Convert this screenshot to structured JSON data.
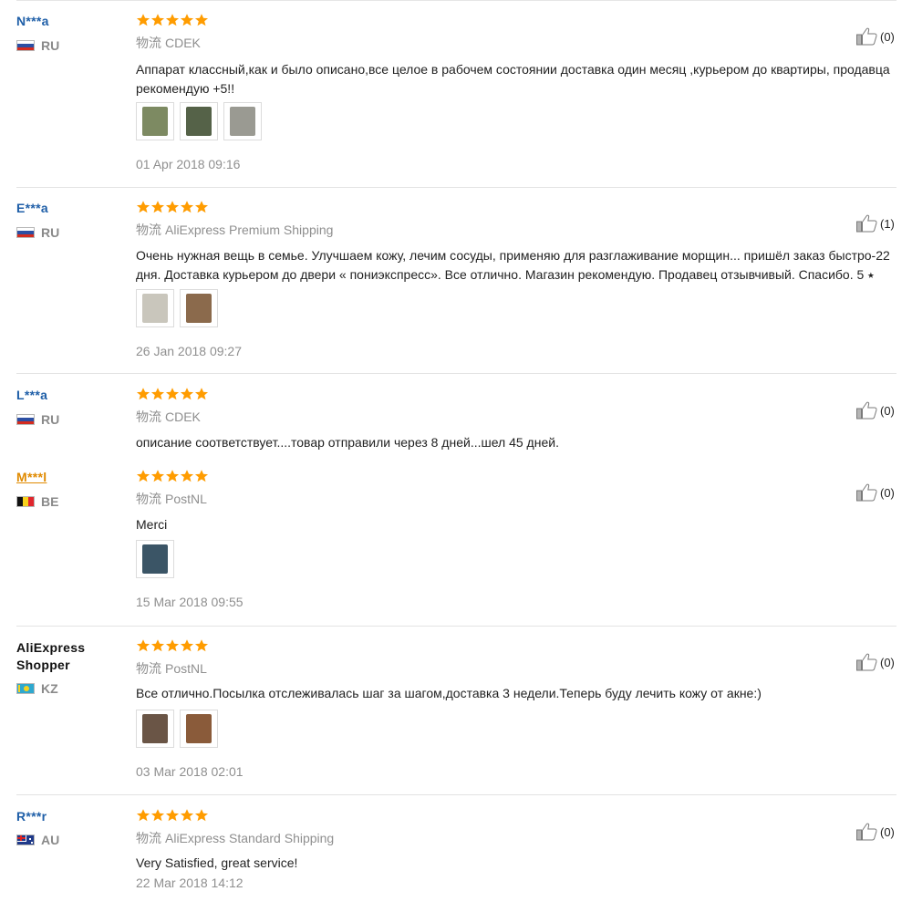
{
  "reviews": [
    {
      "user": "N***a",
      "country": "RU",
      "flag": "ru",
      "stars": 5,
      "logistics_label": "物流",
      "logistics": "CDEK",
      "text": "Аппарат классный,как и было описано,все целое в рабочем состоянии доставка один месяц ,курьером до квартиры, продавца рекомендую +5!!",
      "photos": [
        "photo",
        "photo",
        "photo"
      ],
      "date": "01 Apr 2018 09:16",
      "helpful": "(0)"
    },
    {
      "user": "E***a",
      "country": "RU",
      "flag": "ru",
      "stars": 5,
      "logistics_label": "物流",
      "logistics": "AliExpress Premium Shipping",
      "text": "Очень нужная вещь в семье. Улучшаем кожу, лечим сосуды, применяю для разглаживание морщин... пришёл заказ быстро-22 дня. Доставка курьером до двери « пониэкспресс». Все отлично. Магазин рекомендую. Продавец отзывчивый. Спасибо. 5 ⭑",
      "photos": [
        "photo",
        "photo"
      ],
      "date": "26 Jan 2018 09:27",
      "helpful": "(1)"
    },
    {
      "user": "L***a",
      "country": "RU",
      "flag": "ru",
      "stars": 5,
      "logistics_label": "物流",
      "logistics": "CDEK",
      "text": "описание соответствует....товар отправили через 8 дней...шел 45 дней.",
      "photos": [],
      "date": "",
      "helpful": "(0)"
    },
    {
      "user": "M***l",
      "country": "BE",
      "flag": "be",
      "stars": 5,
      "logistics_label": "物流",
      "logistics": "PostNL",
      "text": "Merci",
      "photos": [
        "photo"
      ],
      "date": "15 Mar 2018 09:55",
      "helpful": "(0)"
    },
    {
      "user": "AliExpress Shopper",
      "country": "KZ",
      "flag": "kz",
      "stars": 5,
      "logistics_label": "物流",
      "logistics": "PostNL",
      "text": "Все отлично.Посылка отслеживалась шаг за шагом,доставка 3 недели.Теперь буду лечить кожу от акне:)",
      "photos": [
        "photo",
        "photo"
      ],
      "date": "03 Mar 2018 02:01",
      "helpful": "(0)"
    },
    {
      "user": "R***r",
      "country": "AU",
      "flag": "au",
      "stars": 5,
      "logistics_label": "物流",
      "logistics": "AliExpress Standard Shipping",
      "text": "Very Satisfied, great service!",
      "photos": [],
      "date": "22 Mar 2018 14:12",
      "helpful": "(0)"
    }
  ],
  "colors": {
    "star": "#ff9c00",
    "username": "#1f5fa8",
    "username_highlight": "#e08a00",
    "muted": "#8f8f8f"
  },
  "icons": {
    "rating": "star-icon",
    "helpful": "thumbs-up-icon",
    "flag": "country-flag-icon"
  }
}
